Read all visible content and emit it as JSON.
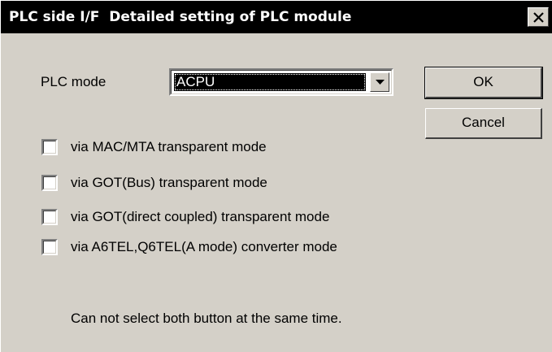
{
  "dialog": {
    "title": "PLC side I/F  Detailed setting of PLC module",
    "close_glyph": "×"
  },
  "plc_mode": {
    "label": "PLC mode",
    "selected": "ACPU"
  },
  "buttons": {
    "ok": "OK",
    "cancel": "Cancel"
  },
  "checkboxes": [
    {
      "label": "via MAC/MTA transparent mode",
      "checked": false
    },
    {
      "label": "via GOT(Bus) transparent mode",
      "checked": false
    },
    {
      "label": "via GOT(direct coupled) transparent mode",
      "checked": false
    },
    {
      "label": "via A6TEL,Q6TEL(A mode) converter mode",
      "checked": false
    }
  ],
  "note": "Can not select both button at the same time.",
  "colors": {
    "titlebar": "#000000",
    "dialog_face": "#d4d0c8",
    "selection": "#000000"
  },
  "icons": {
    "close": "close-icon",
    "dropdown": "chevron-down-icon"
  }
}
